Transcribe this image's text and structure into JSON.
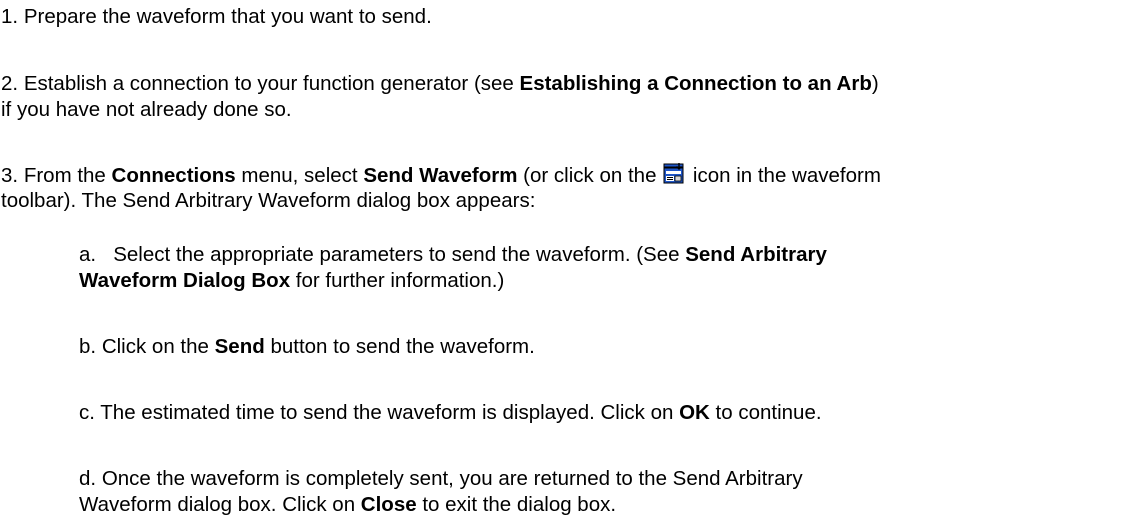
{
  "steps": [
    {
      "number": "1.",
      "text": "Prepare the waveform that you want to send."
    },
    {
      "number": "2.",
      "text_a": "Establish a connection to your function generator (see ",
      "link": "Establishing a Connection to an Arb",
      "text_b": ")",
      "text_c": "if you have not already done so."
    },
    {
      "number": "3.",
      "text_a": "From the ",
      "menu": "Connections",
      "text_b": " menu, select ",
      "command": "Send Waveform",
      "text_c": " (or click on the",
      "text_d": "icon in the waveform",
      "text_e": "toolbar). The Send Arbitrary Waveform dialog box appears:",
      "icon": "send-waveform-icon"
    }
  ],
  "substeps": [
    {
      "letter": "a.",
      "text_a": "Select the appropriate parameters to send the waveform. (See ",
      "link_a": "Send Arbitrary",
      "link_b": "Waveform Dialog Box",
      "text_b": " for further information.)"
    },
    {
      "letter": "b.",
      "text_a": "Click on the ",
      "button": "Send",
      "text_b": " button to send the waveform."
    },
    {
      "letter": "c.",
      "text_a": "The estimated time to send the waveform is displayed. Click on ",
      "button": "OK",
      "text_b": " to continue."
    },
    {
      "letter": "d.",
      "text_a": "Once the waveform is completely sent, you are returned to the Send Arbitrary",
      "text_b": "Waveform dialog box. Click on ",
      "button": "Close",
      "text_c": " to exit the dialog box."
    }
  ]
}
